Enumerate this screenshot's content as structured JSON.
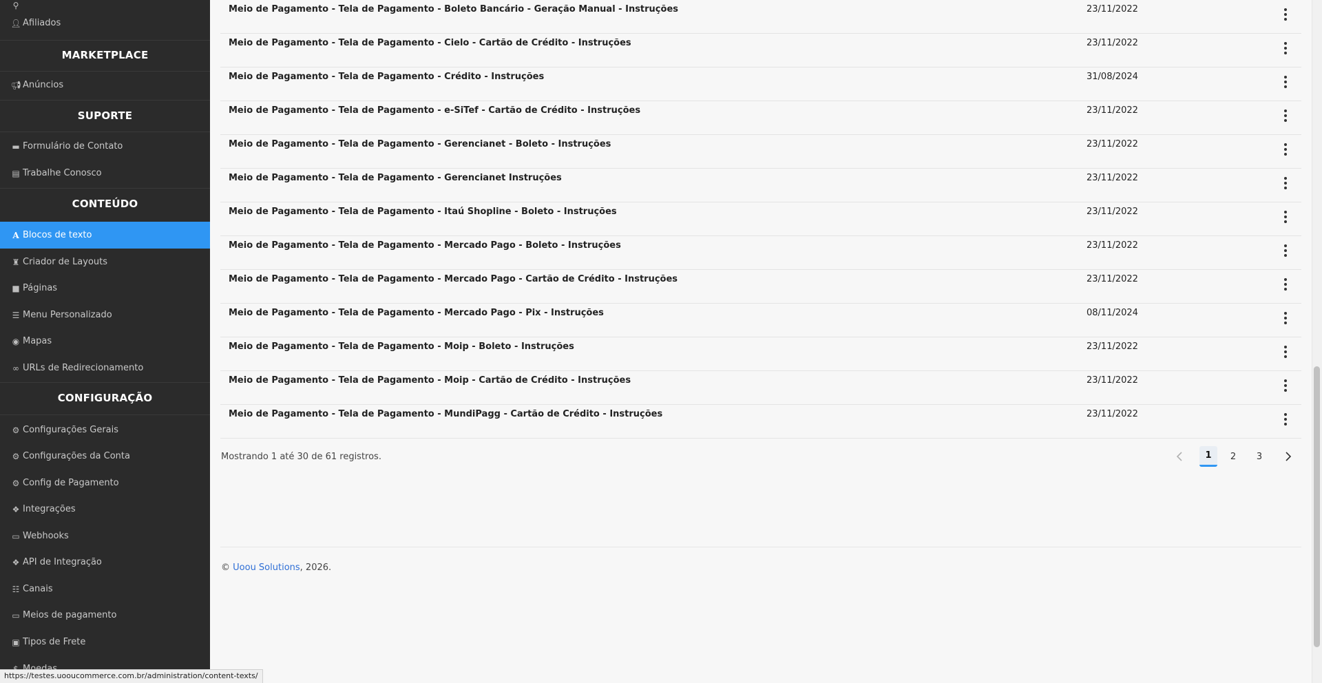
{
  "sidebar": {
    "items_top": [
      {
        "label": "Afiliados",
        "icon": "user-icon"
      }
    ],
    "sections": [
      {
        "heading": "MARKETPLACE",
        "items": [
          {
            "label": "Anúncios",
            "icon": "megaphone-icon"
          }
        ]
      },
      {
        "heading": "SUPORTE",
        "items": [
          {
            "label": "Formulário de Contato",
            "icon": "comment-icon"
          },
          {
            "label": "Trabalhe Conosco",
            "icon": "briefcase-icon"
          }
        ]
      },
      {
        "heading": "CONTEÚDO",
        "items": [
          {
            "label": "Blocos de texto",
            "icon": "font-icon"
          },
          {
            "label": "Criador de Layouts",
            "icon": "chess-rook-icon"
          },
          {
            "label": "Páginas",
            "icon": "file-icon"
          },
          {
            "label": "Menu Personalizado",
            "icon": "list-icon"
          },
          {
            "label": "Mapas",
            "icon": "map-marker-icon"
          },
          {
            "label": "URLs de Redirecionamento",
            "icon": "link-icon"
          }
        ]
      },
      {
        "heading": "CONFIGURAÇÃO",
        "items": [
          {
            "label": "Configurações Gerais",
            "icon": "gear-icon"
          },
          {
            "label": "Configurações da Conta",
            "icon": "gear-icon"
          },
          {
            "label": "Config de Pagamento",
            "icon": "gear-icon"
          },
          {
            "label": "Integrações",
            "icon": "puzzle-icon"
          },
          {
            "label": "Webhooks",
            "icon": "card-icon"
          },
          {
            "label": "API de Integração",
            "icon": "puzzle-icon"
          },
          {
            "label": "Canais",
            "icon": "sitemap-icon"
          },
          {
            "label": "Meios de pagamento",
            "icon": "card-icon"
          },
          {
            "label": "Tipos de Frete",
            "icon": "truck-icon"
          },
          {
            "label": "Moedas",
            "icon": "dollar-icon"
          }
        ]
      }
    ],
    "active_item": "Blocos de texto"
  },
  "table": {
    "rows": [
      {
        "title": "Meio de Pagamento - Tela de Pagamento - Boleto Bancário - Geração Manual - Instruções",
        "date": "23/11/2022"
      },
      {
        "title": "Meio de Pagamento - Tela de Pagamento - Cielo - Cartão de Crédito - Instruções",
        "date": "23/11/2022"
      },
      {
        "title": "Meio de Pagamento - Tela de Pagamento - Crédito - Instruções",
        "date": "31/08/2024"
      },
      {
        "title": "Meio de Pagamento - Tela de Pagamento - e-SiTef - Cartão de Crédito - Instruções",
        "date": "23/11/2022"
      },
      {
        "title": "Meio de Pagamento - Tela de Pagamento - Gerencianet - Boleto - Instruções",
        "date": "23/11/2022"
      },
      {
        "title": "Meio de Pagamento - Tela de Pagamento - Gerencianet Instruções",
        "date": "23/11/2022"
      },
      {
        "title": "Meio de Pagamento - Tela de Pagamento - Itaú Shopline - Boleto - Instruções",
        "date": "23/11/2022"
      },
      {
        "title": "Meio de Pagamento - Tela de Pagamento - Mercado Pago - Boleto - Instruções",
        "date": "23/11/2022"
      },
      {
        "title": "Meio de Pagamento - Tela de Pagamento - Mercado Pago - Cartão de Crédito - Instruções",
        "date": "23/11/2022"
      },
      {
        "title": "Meio de Pagamento - Tela de Pagamento - Mercado Pago - Pix - Instruções",
        "date": "08/11/2024"
      },
      {
        "title": "Meio de Pagamento - Tela de Pagamento - Moip - Boleto - Instruções",
        "date": "23/11/2022"
      },
      {
        "title": "Meio de Pagamento - Tela de Pagamento - Moip - Cartão de Crédito - Instruções",
        "date": "23/11/2022"
      },
      {
        "title": "Meio de Pagamento - Tela de Pagamento - MundiPagg - Cartão de Crédito - Instruções",
        "date": "23/11/2022"
      }
    ]
  },
  "pagination": {
    "summary": "Mostrando 1 até 30 de 61 registros.",
    "pages": [
      "1",
      "2",
      "3"
    ],
    "current": "1",
    "prev": "‹",
    "next": "›"
  },
  "footer": {
    "copyright": "©",
    "company": "Uoou Solutions",
    "year": ", 2026."
  },
  "status_url": "https://testes.uooucommerce.com.br/administration/content-texts/",
  "colors": {
    "sidebar_bg": "#2b2b2b",
    "accent": "#2f96f3",
    "link": "#2f6fd6"
  }
}
